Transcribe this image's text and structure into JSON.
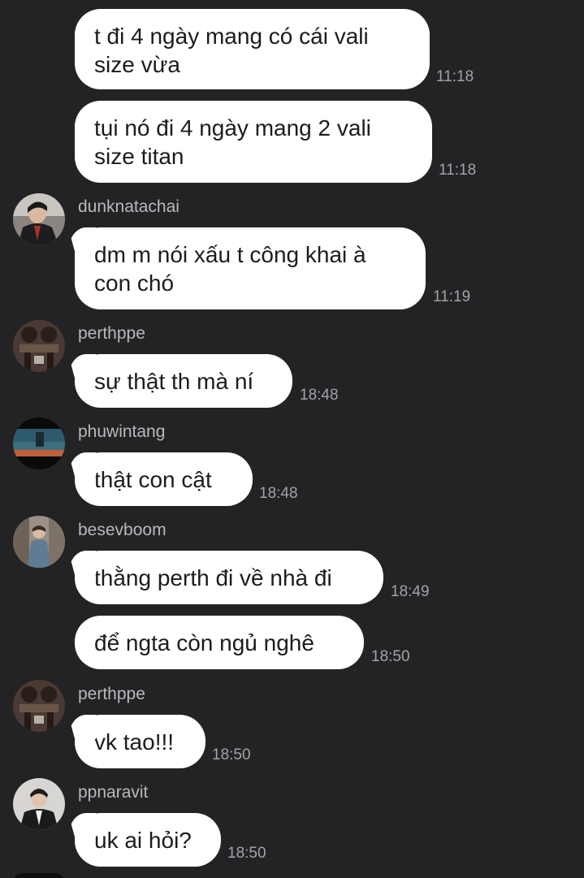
{
  "messages": [
    {
      "text": "t đi 4 ngày mang có cái vali\nsize vừa",
      "time": "11:18"
    },
    {
      "text": "tụi nó đi 4 ngày mang 2 vali\nsize titan",
      "time": "11:18"
    },
    {
      "sender": "dunknatachai",
      "avatar": "avatar-dunknatachai",
      "text": "dm m nói xấu t công khai à\ncon chó",
      "time": "11:19"
    },
    {
      "sender": "perthppe",
      "avatar": "avatar-perthppe",
      "text": "sự thật th mà ní",
      "time": "18:48"
    },
    {
      "sender": "phuwintang",
      "avatar": "avatar-phuwintang",
      "text": "thật con cật",
      "time": "18:48"
    },
    {
      "sender": "besevboom",
      "avatar": "avatar-besevboom",
      "text": "thằng perth đi về nhà đi",
      "time": "18:49"
    },
    {
      "text": "để ngta còn ngủ nghê",
      "time": "18:50"
    },
    {
      "sender": "perthppe",
      "avatar": "avatar-perthppe",
      "text": "vk tao!!!",
      "time": "18:50"
    },
    {
      "sender": "ppnaravit",
      "avatar": "avatar-ppnaravit",
      "text": "uk ai hỏi?",
      "time": "18:50"
    }
  ],
  "colors": {
    "background": "#232325",
    "bubble": "#ffffff",
    "bubble_text": "#1c1c1e",
    "sender_text": "#b9b9bd",
    "time_text": "#a3a3a8"
  }
}
